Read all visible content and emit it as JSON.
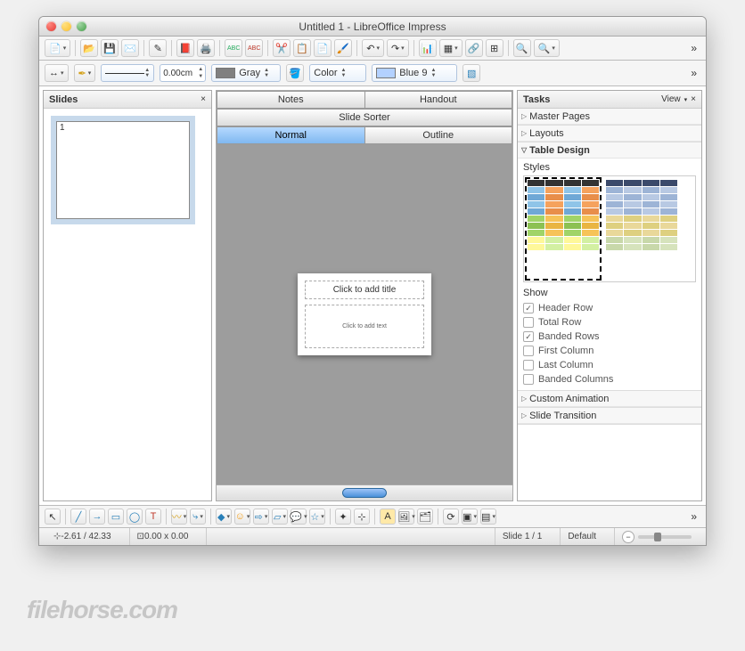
{
  "window": {
    "title": "Untitled 1 - LibreOffice Impress"
  },
  "toolbar2": {
    "width": "0.00cm",
    "area_label": "Gray",
    "color_label": "Color",
    "line_color_label": "Blue 9"
  },
  "slides_panel": {
    "title": "Slides",
    "thumb_number": "1"
  },
  "center": {
    "tabs": {
      "notes": "Notes",
      "handout": "Handout",
      "sorter": "Slide Sorter",
      "normal": "Normal",
      "outline": "Outline"
    },
    "slide": {
      "title_placeholder": "Click to add title",
      "body_placeholder": "Click to add text"
    }
  },
  "tasks": {
    "title": "Tasks",
    "view_label": "View",
    "sections": {
      "master": "Master Pages",
      "layouts": "Layouts",
      "table": "Table Design",
      "anim": "Custom Animation",
      "trans": "Slide Transition"
    },
    "styles_label": "Styles",
    "show_label": "Show",
    "checks": {
      "header_row": "Header Row",
      "total_row": "Total Row",
      "banded_rows": "Banded Rows",
      "first_col": "First Column",
      "last_col": "Last Column",
      "banded_cols": "Banded Columns"
    }
  },
  "status": {
    "pos": "-2.61 / 42.33",
    "size": "0.00 x 0.00",
    "slide": "Slide 1 / 1",
    "style": "Default"
  },
  "watermark": "filehorse.com"
}
